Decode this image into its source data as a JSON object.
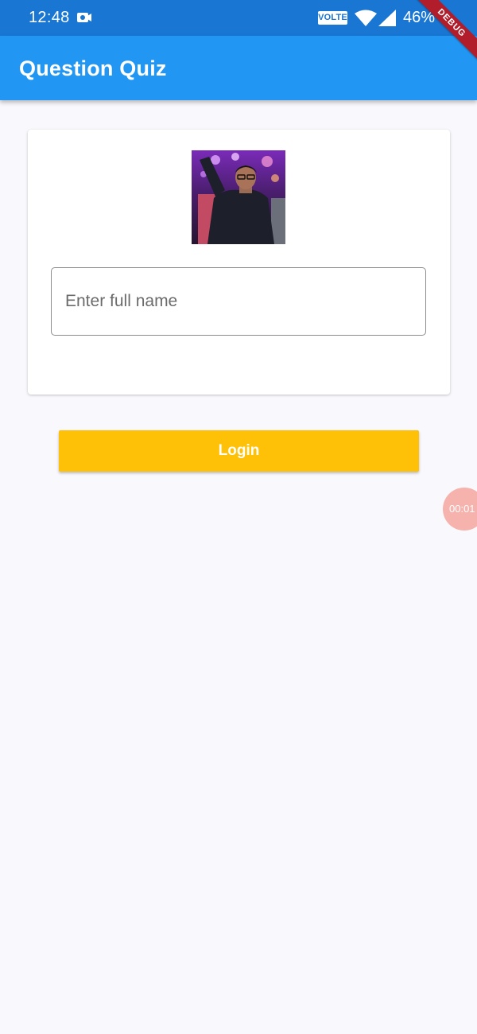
{
  "status_bar": {
    "time": "12:48",
    "volte": "VOLTE",
    "battery": "46%",
    "icons": [
      "camera-icon",
      "wifi-icon",
      "signal-icon"
    ]
  },
  "debug_banner": {
    "label": "DEBUG"
  },
  "app_bar": {
    "title": "Question Quiz",
    "color": "#2196f3"
  },
  "card": {
    "avatar": "profile-photo",
    "name_field": {
      "placeholder": "Enter full name",
      "value": ""
    }
  },
  "login_button": {
    "label": "Login",
    "color": "#ffc107"
  },
  "timer": {
    "label": "00:01"
  }
}
